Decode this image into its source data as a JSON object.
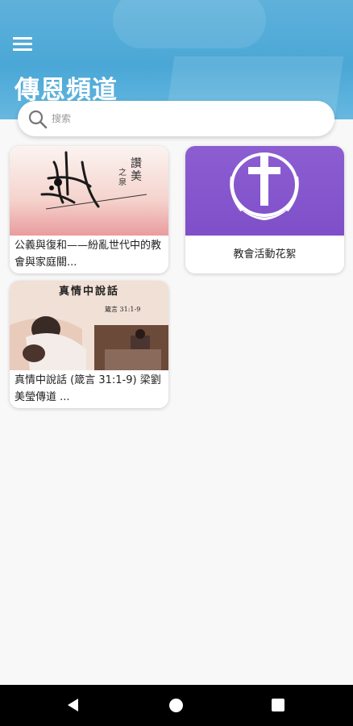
{
  "header": {
    "title": "傳恩頻道",
    "background_color": "#4aa7d6"
  },
  "search": {
    "placeholder": "搜索"
  },
  "cards": [
    {
      "caption": "公義與復和——紛亂世代中的教會與家庭關...",
      "thumb_text": "讚美之泉"
    },
    {
      "caption": "教會活動花絮",
      "thumb_color": "#8656cd"
    },
    {
      "caption": "真情中說話 (箴言 31:1-9) 梁劉美瑩傳道 ...",
      "thumb_title": "真情中說話",
      "thumb_verse": "箴言 31:1-9"
    }
  ],
  "navbar": {
    "icons": [
      "back-icon",
      "home-icon",
      "recent-apps-icon"
    ]
  }
}
